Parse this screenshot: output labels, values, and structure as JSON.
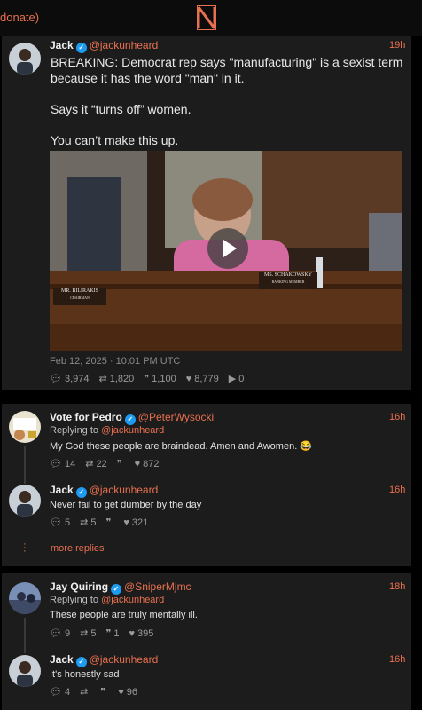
{
  "top": {
    "left_text": "donate)"
  },
  "main_post": {
    "name": "Jack",
    "handle": "@jackunheard",
    "time": "19h",
    "lines": [
      "BREAKING: Democrat rep says \"manufacturing\" is a sexist term",
      "because it has the word \"man\" in it.",
      "Says it “turns off” women.",
      "You can’t make this up."
    ],
    "video": {
      "placard_left": "MR. BILIRAKIS",
      "placard_left_sub": "CHAIRMAN",
      "placard_right": "MS. SCHAKOWSKY",
      "placard_right_sub": "RANKING MEMBER"
    },
    "date": "Feb 12, 2025 · 10:01 PM UTC",
    "stats": {
      "replies": "3,974",
      "reposts": "1,820",
      "quotes": "1,100",
      "likes": "8,779",
      "views": "0"
    }
  },
  "thread1": {
    "reply": {
      "name": "Vote for Pedro",
      "handle": "@PeterWysocki",
      "time": "16h",
      "replying_label": "Replying to",
      "replying_handle": "@jackunheard",
      "text": "My God these people are braindead.  Amen and Awomen.",
      "emoji": "😂",
      "stats": {
        "replies": "14",
        "reposts": "22",
        "quotes": "",
        "likes": "872"
      }
    },
    "sub": {
      "name": "Jack",
      "handle": "@jackunheard",
      "time": "16h",
      "text": "Never fail to get dumber by the day",
      "stats": {
        "replies": "5",
        "reposts": "5",
        "quotes": "",
        "likes": "321"
      }
    },
    "more": "more replies"
  },
  "thread2": {
    "reply": {
      "name": "Jay Quiring",
      "handle": "@SniperMjmc",
      "time": "18h",
      "replying_label": "Replying to",
      "replying_handle": "@jackunheard",
      "text": "These people are truly mentally ill.",
      "stats": {
        "replies": "9",
        "reposts": "5",
        "quotes": "1",
        "likes": "395"
      }
    },
    "sub": {
      "name": "Jack",
      "handle": "@jackunheard",
      "time": "16h",
      "text": "It's honestly sad",
      "stats": {
        "replies": "4",
        "reposts": "",
        "quotes": "",
        "likes": "96"
      }
    }
  },
  "icons": {
    "reply": "comment-icon",
    "repost": "repost-icon",
    "quote": "quote-icon",
    "like": "heart-icon",
    "views": "play-icon"
  },
  "colors": {
    "accent": "#e8704f",
    "verified": "#1d9bf0",
    "card": "#1c1c1c",
    "background": "#000000"
  }
}
